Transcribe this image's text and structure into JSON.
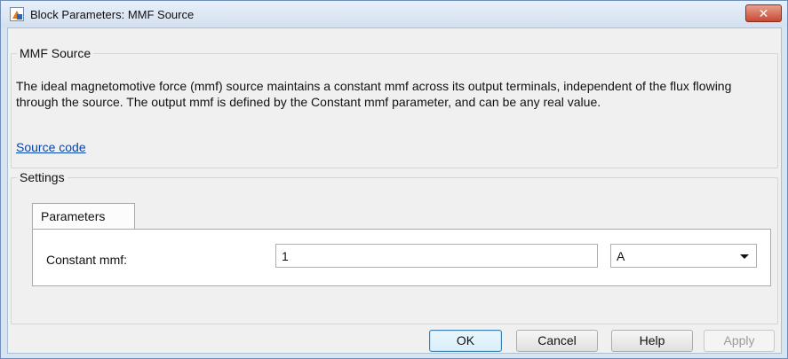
{
  "window": {
    "title": "Block Parameters: MMF Source",
    "close_label": "✕"
  },
  "block": {
    "group_title": "MMF Source",
    "description": "The ideal magnetomotive force (mmf) source maintains a constant mmf across its output terminals, independent of the flux flowing through the source. The output mmf is defined by the Constant mmf parameter, and can be any real value.",
    "source_link": "Source code"
  },
  "settings": {
    "group_title": "Settings",
    "tabs": [
      {
        "label": "Parameters",
        "active": true
      }
    ],
    "params": [
      {
        "label": "Constant mmf:",
        "value": "1",
        "unit": "A"
      }
    ]
  },
  "buttons": {
    "ok": "OK",
    "cancel": "Cancel",
    "help": "Help",
    "apply": "Apply"
  },
  "colors": {
    "link": "#0645ad",
    "close_button": "#c64a32",
    "default_button_border": "#3c7fb1"
  }
}
